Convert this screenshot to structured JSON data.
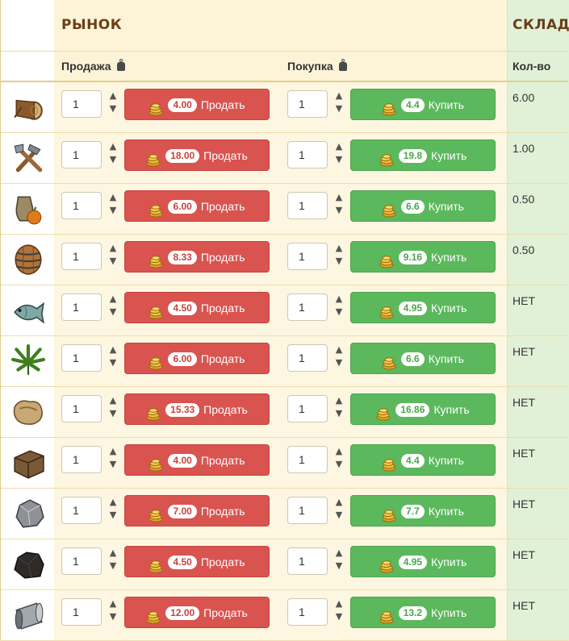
{
  "header": {
    "market_title": "РЫНОК",
    "stock_title": "СКЛАД",
    "sell_label": "Продажа",
    "buy_label": "Покупка",
    "qty_label": "Кол-во"
  },
  "buttons": {
    "sell": "Продать",
    "buy": "Купить"
  },
  "items": [
    {
      "icon": "log-icon",
      "sell_qty": "1",
      "sell_price": "4.00",
      "buy_qty": "1",
      "buy_price": "4.4",
      "stock": "6.00"
    },
    {
      "icon": "tools-icon",
      "sell_qty": "1",
      "sell_price": "18.00",
      "buy_qty": "1",
      "buy_price": "19.8",
      "stock": "1.00"
    },
    {
      "icon": "food-jug-icon",
      "sell_qty": "1",
      "sell_price": "6.00",
      "buy_qty": "1",
      "buy_price": "6.6",
      "stock": "0.50"
    },
    {
      "icon": "barrel-icon",
      "sell_qty": "1",
      "sell_price": "8.33",
      "buy_qty": "1",
      "buy_price": "9.16",
      "stock": "0.50"
    },
    {
      "icon": "fish-icon",
      "sell_qty": "1",
      "sell_price": "4.50",
      "buy_qty": "1",
      "buy_price": "4.95",
      "stock": "НЕТ"
    },
    {
      "icon": "hemp-leaf-icon",
      "sell_qty": "1",
      "sell_price": "6.00",
      "buy_qty": "1",
      "buy_price": "6.6",
      "stock": "НЕТ"
    },
    {
      "icon": "leather-icon",
      "sell_qty": "1",
      "sell_price": "15.33",
      "buy_qty": "1",
      "buy_price": "16.86",
      "stock": "НЕТ"
    },
    {
      "icon": "crate-icon",
      "sell_qty": "1",
      "sell_price": "4.00",
      "buy_qty": "1",
      "buy_price": "4.4",
      "stock": "НЕТ"
    },
    {
      "icon": "iron-ore-icon",
      "sell_qty": "1",
      "sell_price": "7.00",
      "buy_qty": "1",
      "buy_price": "7.7",
      "stock": "НЕТ"
    },
    {
      "icon": "coal-icon",
      "sell_qty": "1",
      "sell_price": "4.50",
      "buy_qty": "1",
      "buy_price": "4.95",
      "stock": "НЕТ"
    },
    {
      "icon": "metal-pipe-icon",
      "sell_qty": "1",
      "sell_price": "12.00",
      "buy_qty": "1",
      "buy_price": "13.2",
      "stock": "НЕТ"
    }
  ],
  "colors": {
    "sell": "#d9534f",
    "buy": "#5cb85c",
    "stock_bg": "#e1f1d8",
    "title": "#6b3f16"
  }
}
